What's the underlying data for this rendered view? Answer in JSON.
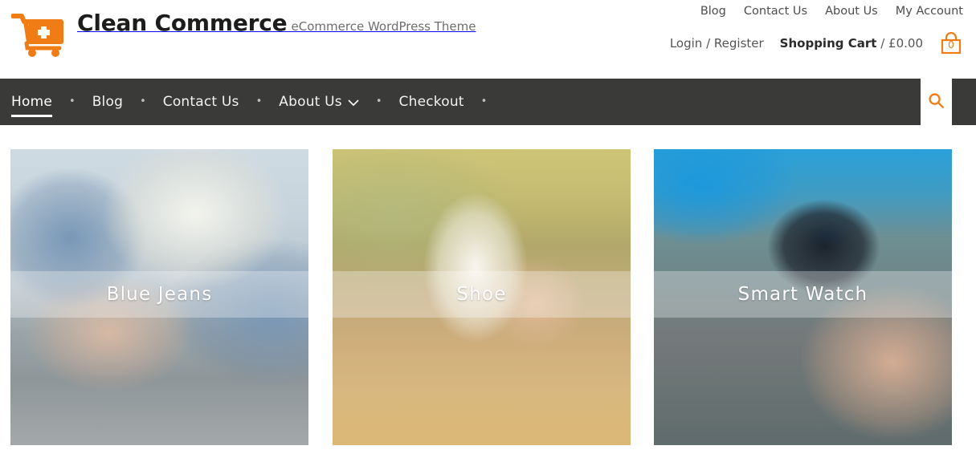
{
  "site": {
    "brand_title": "Clean Commerce",
    "brand_tagline": "eCommerce WordPress Theme",
    "logo_icon": "shopping-cart-plus-icon",
    "accent_color": "#f07c15",
    "nav_bg_color": "#3a3a38"
  },
  "top_links": [
    {
      "label": "Blog"
    },
    {
      "label": "Contact Us"
    },
    {
      "label": "About Us"
    },
    {
      "label": "My Account"
    }
  ],
  "account_bar": {
    "login_label": "Login / Register",
    "cart_label": "Shopping Cart",
    "cart_separator": "/",
    "cart_total": "£0.00",
    "cart_count": "0",
    "bag_icon": "shopping-bag-icon"
  },
  "main_nav": {
    "separator": "•",
    "items": [
      {
        "label": "Home",
        "active": true,
        "has_dropdown": false
      },
      {
        "label": "Blog",
        "active": false,
        "has_dropdown": false
      },
      {
        "label": "Contact Us",
        "active": false,
        "has_dropdown": false
      },
      {
        "label": "About Us",
        "active": false,
        "has_dropdown": true
      },
      {
        "label": "Checkout",
        "active": false,
        "has_dropdown": false
      }
    ],
    "dropdown_icon": "chevron-down-icon",
    "search_icon": "search-icon"
  },
  "product_cards": [
    {
      "title": "Blue Jeans",
      "image": "woman-sitting-in-blue-jeans"
    },
    {
      "title": "Shoe",
      "image": "white-sneakers-on-grass"
    },
    {
      "title": "Smart Watch",
      "image": "wrist-wearing-smart-watch"
    }
  ]
}
